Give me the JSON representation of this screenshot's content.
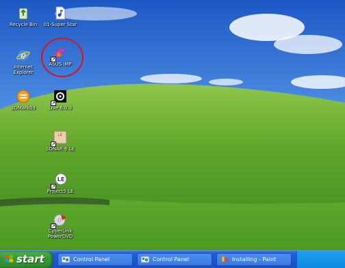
{
  "desktop": {
    "icons": [
      {
        "label": "Recycle Bin",
        "icon": "recycle-bin-icon",
        "shortcut": false
      },
      {
        "label": "01-Super Star",
        "icon": "mp3-file-icon",
        "shortcut": false
      },
      {
        "label": "Internet\nExplorer",
        "icon": "internet-explorer-icon",
        "shortcut": false
      },
      {
        "label": "ASUS iMP",
        "icon": "asus-imp-icon",
        "shortcut": true
      },
      {
        "label": "3DMark03",
        "icon": "3dmark-icon",
        "shortcut": false
      },
      {
        "label": "Live 6.0.3",
        "icon": "live-app-icon",
        "shortcut": true
      },
      {
        "label": "SONAR 6 LE",
        "icon": "sonar-icon",
        "shortcut": true
      },
      {
        "label": "Project5 LE",
        "icon": "project5-icon",
        "shortcut": true
      },
      {
        "label": "CyberLink\nPowerDVD",
        "icon": "powerdvd-icon",
        "shortcut": true
      }
    ],
    "highlight_color": "#e0101a"
  },
  "taskbar": {
    "start_label": "start",
    "tasks": [
      {
        "label": "Control Panel",
        "icon": "control-panel-icon"
      },
      {
        "label": "Control Panel",
        "icon": "control-panel-icon"
      },
      {
        "label": "Installing - Paint",
        "icon": "paint-icon"
      }
    ]
  }
}
